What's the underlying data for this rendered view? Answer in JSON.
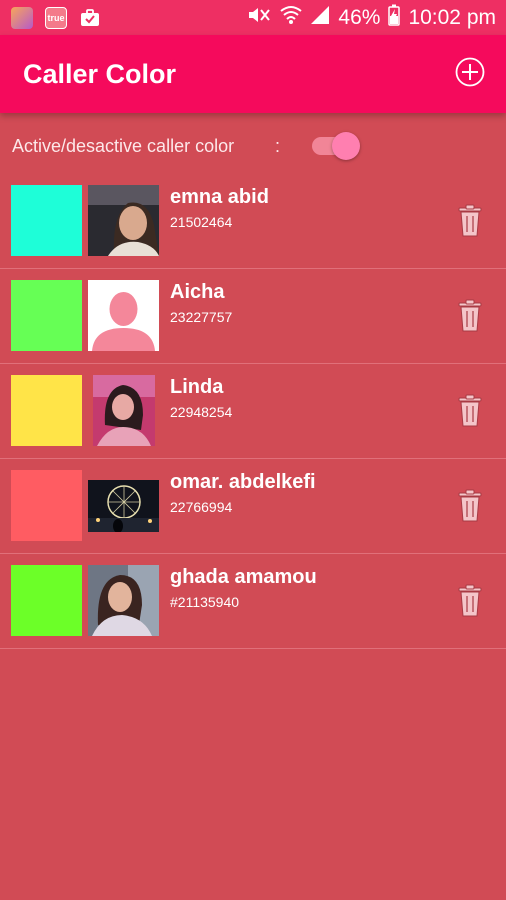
{
  "status_bar": {
    "battery": "46%",
    "time": "10:02 pm",
    "icons": [
      "app-icon",
      "true-app-icon",
      "briefcase-icon",
      "mute-icon",
      "wifi-icon",
      "signal-icon",
      "battery-charging-icon"
    ],
    "true_label": "true"
  },
  "app_bar": {
    "title": "Caller Color",
    "add_icon": "add-circle-icon"
  },
  "toggle": {
    "label": "Active/desactive caller color",
    "colon": ":",
    "state": "on"
  },
  "contacts": [
    {
      "name": "emna abid",
      "number": "21502464",
      "color": "#1efed8",
      "photo": "photo"
    },
    {
      "name": "Aicha",
      "number": "23227757",
      "color": "#66ff55",
      "photo": "default-avatar"
    },
    {
      "name": "Linda",
      "number": "22948254",
      "color": "#ffe448",
      "photo": "photo"
    },
    {
      "name": "omar. abdelkefi",
      "number": "22766994",
      "color": "#ff5c62",
      "photo": "photo"
    },
    {
      "name": "ghada amamou",
      "number": "#21135940",
      "color": "#6cff28",
      "photo": "photo"
    }
  ],
  "colors": {
    "background": "#d14b55",
    "status_bar": "#ee2f63",
    "app_bar": "#f50a5c",
    "trash_icon": "#f4c5c9",
    "avatar_pink": "#f4879a"
  }
}
